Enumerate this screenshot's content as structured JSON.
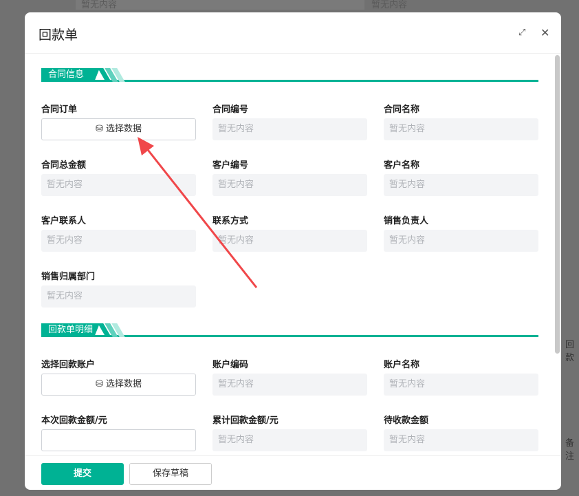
{
  "background": {
    "placeholder1": "暂无内容",
    "placeholder2": "暂无内容",
    "text_right1": "回款",
    "text_right2": "备注"
  },
  "modal": {
    "title": "回款单",
    "expand_icon": "expand-icon",
    "close_icon": "close-icon"
  },
  "sections": [
    {
      "title": "合同信息",
      "fields": [
        {
          "label": "合同订单",
          "type": "button",
          "value": "选择数据"
        },
        {
          "label": "合同编号",
          "type": "readonly",
          "value": "暂无内容"
        },
        {
          "label": "合同名称",
          "type": "readonly",
          "value": "暂无内容"
        },
        {
          "label": "合同总金额",
          "type": "readonly",
          "value": "暂无内容"
        },
        {
          "label": "客户编号",
          "type": "readonly",
          "value": "暂无内容"
        },
        {
          "label": "客户名称",
          "type": "readonly",
          "value": "暂无内容"
        },
        {
          "label": "客户联系人",
          "type": "readonly",
          "value": "暂无内容"
        },
        {
          "label": "联系方式",
          "type": "readonly",
          "value": "暂无内容"
        },
        {
          "label": "销售负责人",
          "type": "readonly",
          "value": "暂无内容"
        },
        {
          "label": "销售归属部门",
          "type": "readonly",
          "value": "暂无内容"
        }
      ]
    },
    {
      "title": "回款单明细",
      "fields": [
        {
          "label": "选择回款账户",
          "type": "button",
          "value": "选择数据"
        },
        {
          "label": "账户编码",
          "type": "readonly",
          "value": "暂无内容"
        },
        {
          "label": "账户名称",
          "type": "readonly",
          "value": "暂无内容"
        },
        {
          "label": "本次回款金额/元",
          "type": "input",
          "value": ""
        },
        {
          "label": "累计回款金额/元",
          "type": "readonly",
          "value": "暂无内容"
        },
        {
          "label": "待收款金额",
          "type": "readonly",
          "value": "暂无内容"
        }
      ]
    }
  ],
  "footer": {
    "submit": "提交",
    "save_draft": "保存草稿"
  },
  "colors": {
    "accent": "#00b294",
    "arrow": "#f0474a"
  }
}
